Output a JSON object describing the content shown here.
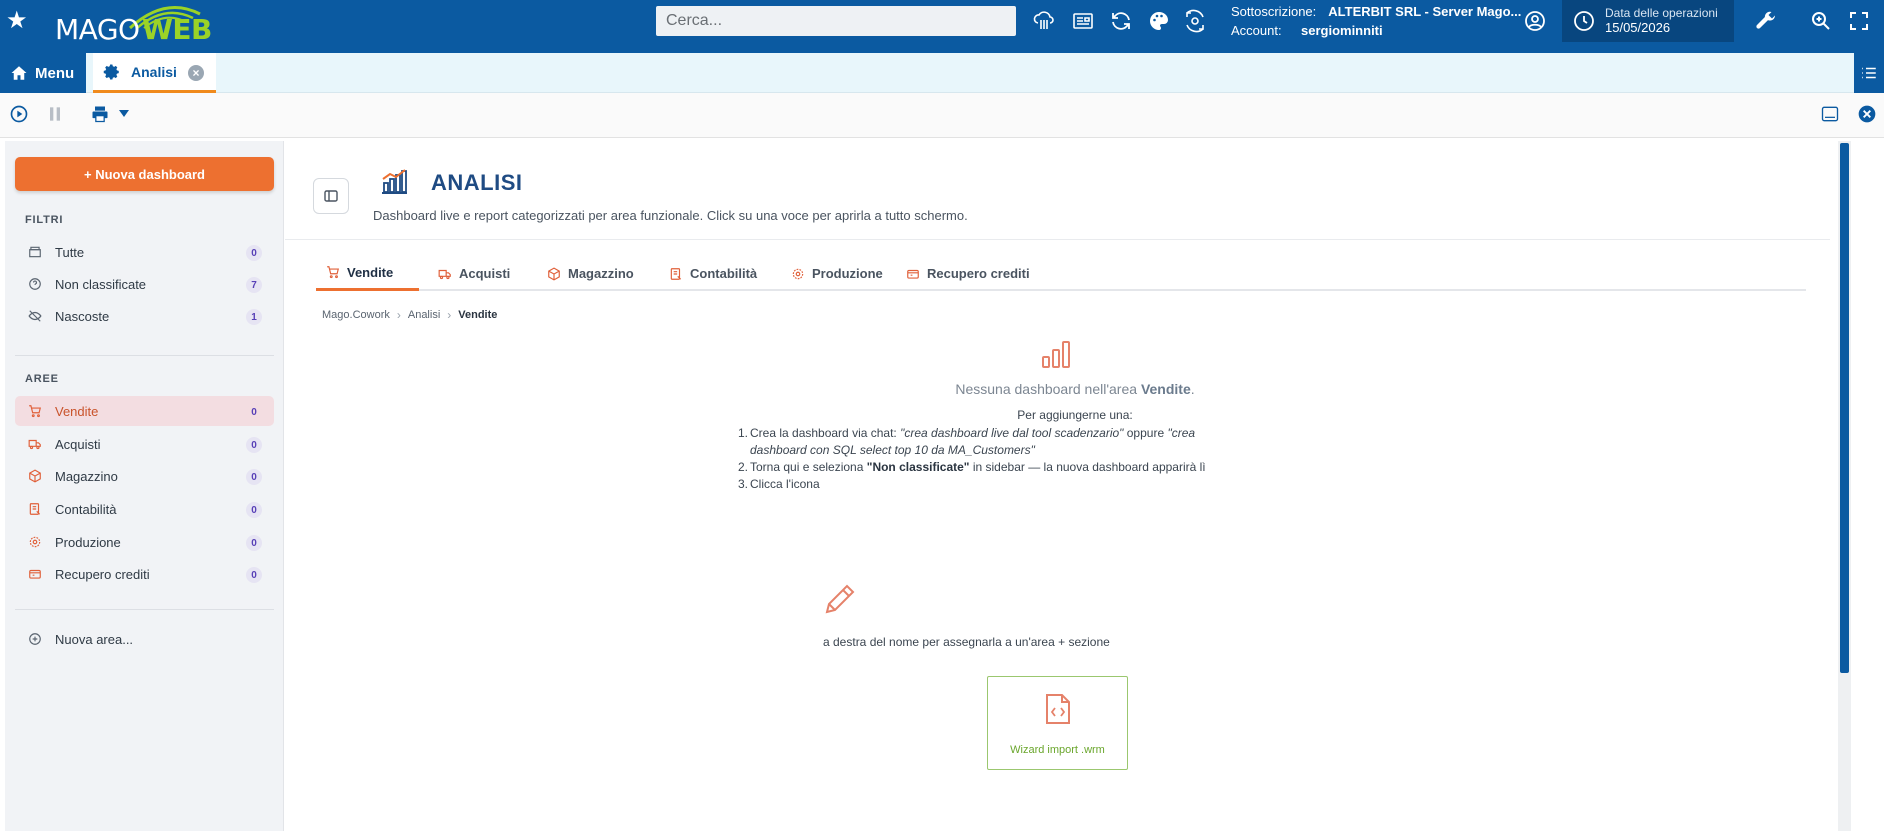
{
  "app": {
    "logo_mago": "MAGO",
    "logo_web": "WEB",
    "search_placeholder": "Cerca...",
    "subscription_label": "Sottoscrizione:",
    "subscription_value": "ALTERBIT SRL - Server Mago...",
    "account_label": "Account:",
    "account_value": "sergiominniti",
    "opdate_label": "Data delle operazioni",
    "opdate_value": "15/05/2026"
  },
  "tabbar": {
    "menu_label": "Menu",
    "doc_tab_label": "Analisi",
    "doc_tab_close": "×"
  },
  "sidebar": {
    "new_dashboard_label": "+ Nuova dashboard",
    "filters_title": "FILTRI",
    "filters": [
      {
        "label": "Tutte",
        "count": "0",
        "icon": "box-icon"
      },
      {
        "label": "Non classificate",
        "count": "7",
        "icon": "question-icon"
      },
      {
        "label": "Nascoste",
        "count": "1",
        "icon": "eye-off-icon"
      }
    ],
    "areas_title": "AREE",
    "areas": [
      {
        "label": "Vendite",
        "count": "0",
        "icon": "cart-icon",
        "active": true
      },
      {
        "label": "Acquisti",
        "count": "0",
        "icon": "truck-icon"
      },
      {
        "label": "Magazzino",
        "count": "0",
        "icon": "package-icon"
      },
      {
        "label": "Contabilità",
        "count": "0",
        "icon": "ledger-icon"
      },
      {
        "label": "Produzione",
        "count": "0",
        "icon": "cog-icon"
      },
      {
        "label": "Recupero crediti",
        "count": "0",
        "icon": "wallet-icon"
      }
    ],
    "new_area_label": "Nuova area..."
  },
  "main": {
    "title": "ANALISI",
    "subtitle": "Dashboard live e report categorizzati per area funzionale. Click su una voce per aprirla a tutto schermo.",
    "tabs": [
      {
        "label": "Vendite",
        "active": true
      },
      {
        "label": "Acquisti"
      },
      {
        "label": "Magazzino"
      },
      {
        "label": "Contabilità"
      },
      {
        "label": "Produzione"
      },
      {
        "label": "Recupero crediti"
      }
    ],
    "breadcrumb": [
      "Mago.Cowork",
      "Analisi",
      "Vendite"
    ],
    "empty": {
      "msg_prefix": "Nessuna dashboard nell'area ",
      "msg_area": "Vendite",
      "msg_suffix": ".",
      "howto": "Per aggiungerne una:",
      "step1_num": "1.",
      "step1_a": "Crea la dashboard via chat: ",
      "step1_b": "\"crea dashboard live dal tool scadenzario\"",
      "step1_c": " oppure ",
      "step1_d": "\"crea dashboard con SQL select top 10 da MA_Customers\"",
      "step2_num": "2.",
      "step2_a": "Torna qui e seleziona ",
      "step2_b": "\"Non classificate\"",
      "step2_c": " in sidebar — la nuova dashboard apparirà lì",
      "step3_num": "3.",
      "step3_a": "Clicca l'icona",
      "assign_text": "a destra del nome per assegnarla a un'area + sezione",
      "wizard_label": "Wizard import .wrm"
    }
  },
  "colors": {
    "topbar": "#0b5aa1",
    "accent_orange": "#ed7030",
    "brand_green": "#9bd327",
    "wizard_green": "#6aa62c"
  }
}
